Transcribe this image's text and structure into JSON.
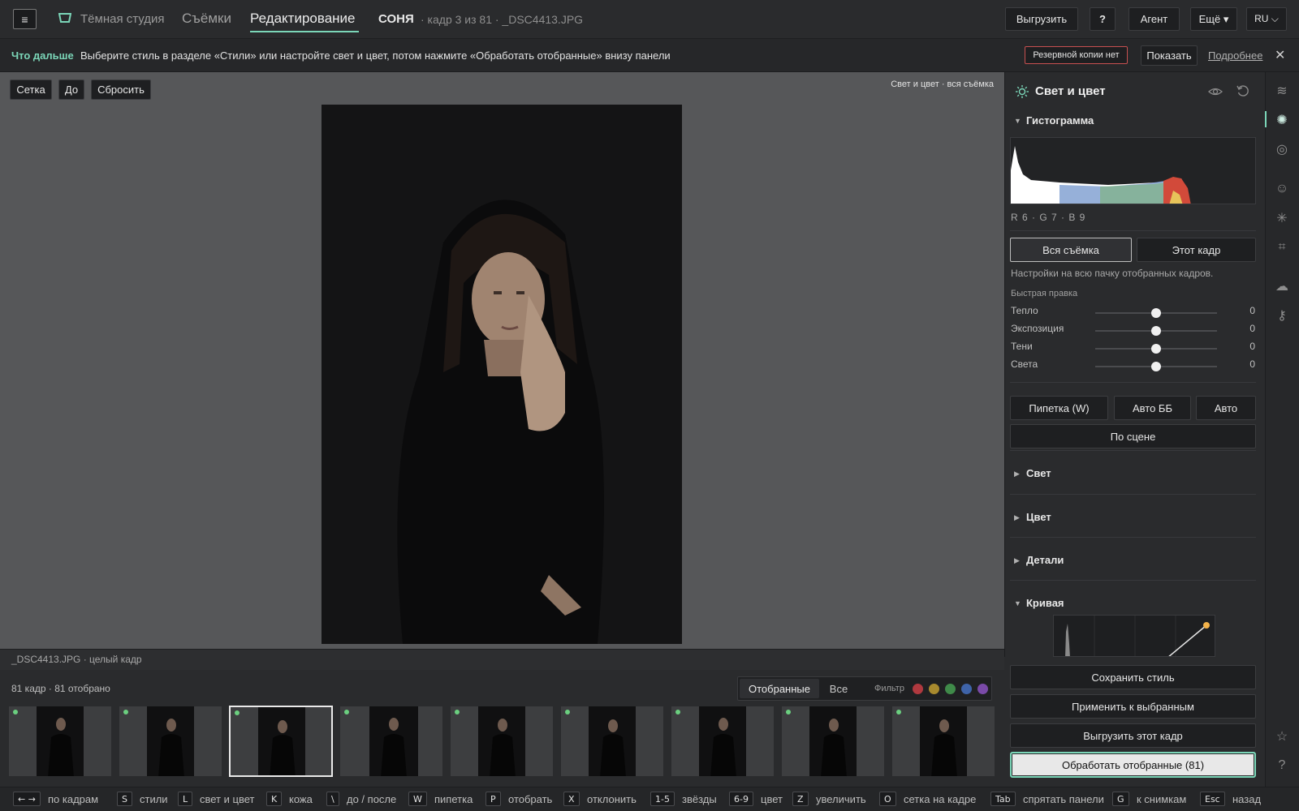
{
  "topbar": {
    "menu_icon": "≡",
    "studio_name": "Тёмная студия",
    "nav_shoots": "Съёмки",
    "nav_edit": "Редактирование",
    "client_name": "СОНЯ",
    "frame_info": "· кадр 3 из 81 · _DSC4413.JPG",
    "export": "Выгрузить",
    "help": "?",
    "agent": "Агент",
    "more": "Ещё ▾",
    "lang": "RU ⌵",
    "accent": "#7bd6b8"
  },
  "infobar": {
    "next_label": "Что дальше",
    "next_text": "Выберите стиль в разделе «Стили» или настройте свет и цвет, потом нажмите «Обработать отобранные» внизу панели",
    "backup_badge": "Резервной копии нет",
    "show": "Показать",
    "details": "Подробнее",
    "close": "✕"
  },
  "viewer": {
    "grid": "Сетка",
    "before": "До",
    "reset": "Сбросить",
    "caption": "Свет и цвет · вся съёмка",
    "filename_caption": "_DSC4413.JPG · целый кадр"
  },
  "filmstrip": {
    "count": "81 кадр · 81 отобрано",
    "tab_picked": "Отобранные",
    "tab_all": "Все",
    "filter": "Фильтр",
    "filter_colors": [
      "#b0393f",
      "#a88a2e",
      "#3f8a49",
      "#3e63a8",
      "#7a4aa8"
    ],
    "thumbs": [
      {
        "name": "thumb-1"
      },
      {
        "name": "thumb-2"
      },
      {
        "name": "thumb-3",
        "selected": true
      },
      {
        "name": "thumb-4"
      },
      {
        "name": "thumb-5"
      },
      {
        "name": "thumb-6"
      },
      {
        "name": "thumb-7"
      },
      {
        "name": "thumb-8"
      },
      {
        "name": "thumb-9"
      }
    ]
  },
  "statusbar": [
    {
      "key": "← →",
      "desc": "по кадрам"
    },
    {
      "key": "S",
      "desc": "стили"
    },
    {
      "key": "L",
      "desc": "свет и цвет"
    },
    {
      "key": "K",
      "desc": "кожа"
    },
    {
      "key": "\\",
      "desc": "до / после"
    },
    {
      "key": "W",
      "desc": "пипетка"
    },
    {
      "key": "P",
      "desc": "отобрать"
    },
    {
      "key": "X",
      "desc": "отклонить"
    },
    {
      "key": "1-5",
      "desc": "звёзды"
    },
    {
      "key": "6-9",
      "desc": "цвет"
    },
    {
      "key": "Z",
      "desc": "увеличить"
    },
    {
      "key": "O",
      "desc": "сетка на кадре"
    },
    {
      "key": "Tab",
      "desc": "спрятать панели"
    },
    {
      "key": "G",
      "desc": "к снимкам"
    },
    {
      "key": "Esc",
      "desc": "назад"
    }
  ],
  "panel": {
    "title": "Свет и цвет",
    "histogram_title": "Гистограмма",
    "histogram_readout": "R 6 · G 7 · B 9",
    "scope_all": "Вся съёмка",
    "scope_this": "Этот кадр",
    "scope_hint": "Настройки на всю пачку отобранных кадров.",
    "quick_label": "Быстрая правка",
    "sliders": [
      {
        "label": "Тепло",
        "value": "0"
      },
      {
        "label": "Экспозиция",
        "value": "0"
      },
      {
        "label": "Тени",
        "value": "0"
      },
      {
        "label": "Света",
        "value": "0"
      }
    ],
    "pipette": "Пипетка (W)",
    "auto_wb": "Авто ББ",
    "auto": "Авто",
    "by_scene": "По сцене",
    "sections": [
      {
        "label": "Свет",
        "open": false
      },
      {
        "label": "Цвет",
        "open": false
      },
      {
        "label": "Детали",
        "open": false
      },
      {
        "label": "Кривая",
        "open": true
      }
    ],
    "save_style": "Сохранить стиль",
    "apply_selected": "Применить к выбранным",
    "export_this": "Выгрузить этот кадр",
    "process_selected": "Обработать отобранные (81)"
  },
  "rail_icons": [
    "layers-icon",
    "sun-icon",
    "target-icon",
    "face-icon",
    "sparkle-icon",
    "crop-icon",
    "cloud-icon",
    "key-icon",
    "star-icon",
    "help-circle-icon"
  ]
}
